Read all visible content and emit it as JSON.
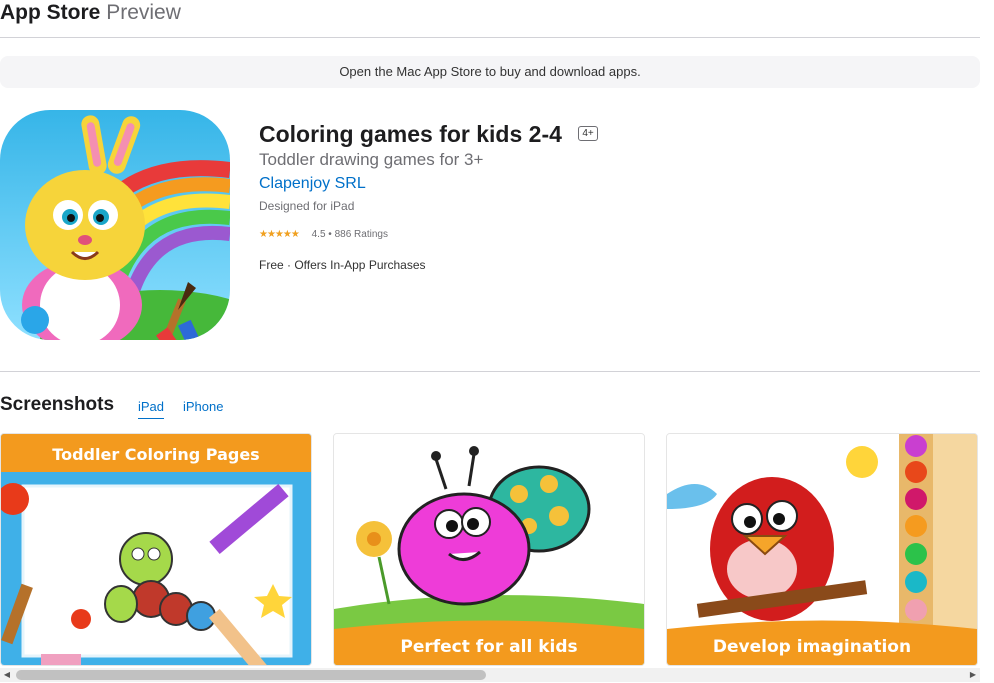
{
  "header": {
    "brand": "App Store",
    "brand_suffix": "Preview"
  },
  "banner": {
    "text": "Open the Mac App Store to buy and download apps."
  },
  "app": {
    "title": "Coloring games for kids 2-4",
    "age_rating": "4+",
    "subtitle": "Toddler drawing games for 3+",
    "developer": "Clapenjoy SRL",
    "designed_for": "Designed for iPad",
    "stars": "★★★★★",
    "rating_value": 4.5,
    "rating_text": "4.5 • 886 Ratings",
    "price_text": "Free · Offers In-App Purchases"
  },
  "screenshots": {
    "title": "Screenshots",
    "tabs": [
      {
        "label": "iPad",
        "active": true
      },
      {
        "label": "iPhone",
        "active": false
      }
    ],
    "items": [
      {
        "caption": "Toddler Coloring Pages"
      },
      {
        "caption": "Perfect for all kids"
      },
      {
        "caption": "Develop imagination"
      }
    ]
  },
  "colors": {
    "link": "#0070c9",
    "star": "#f0a020",
    "caption_orange": "#f39a1e"
  }
}
